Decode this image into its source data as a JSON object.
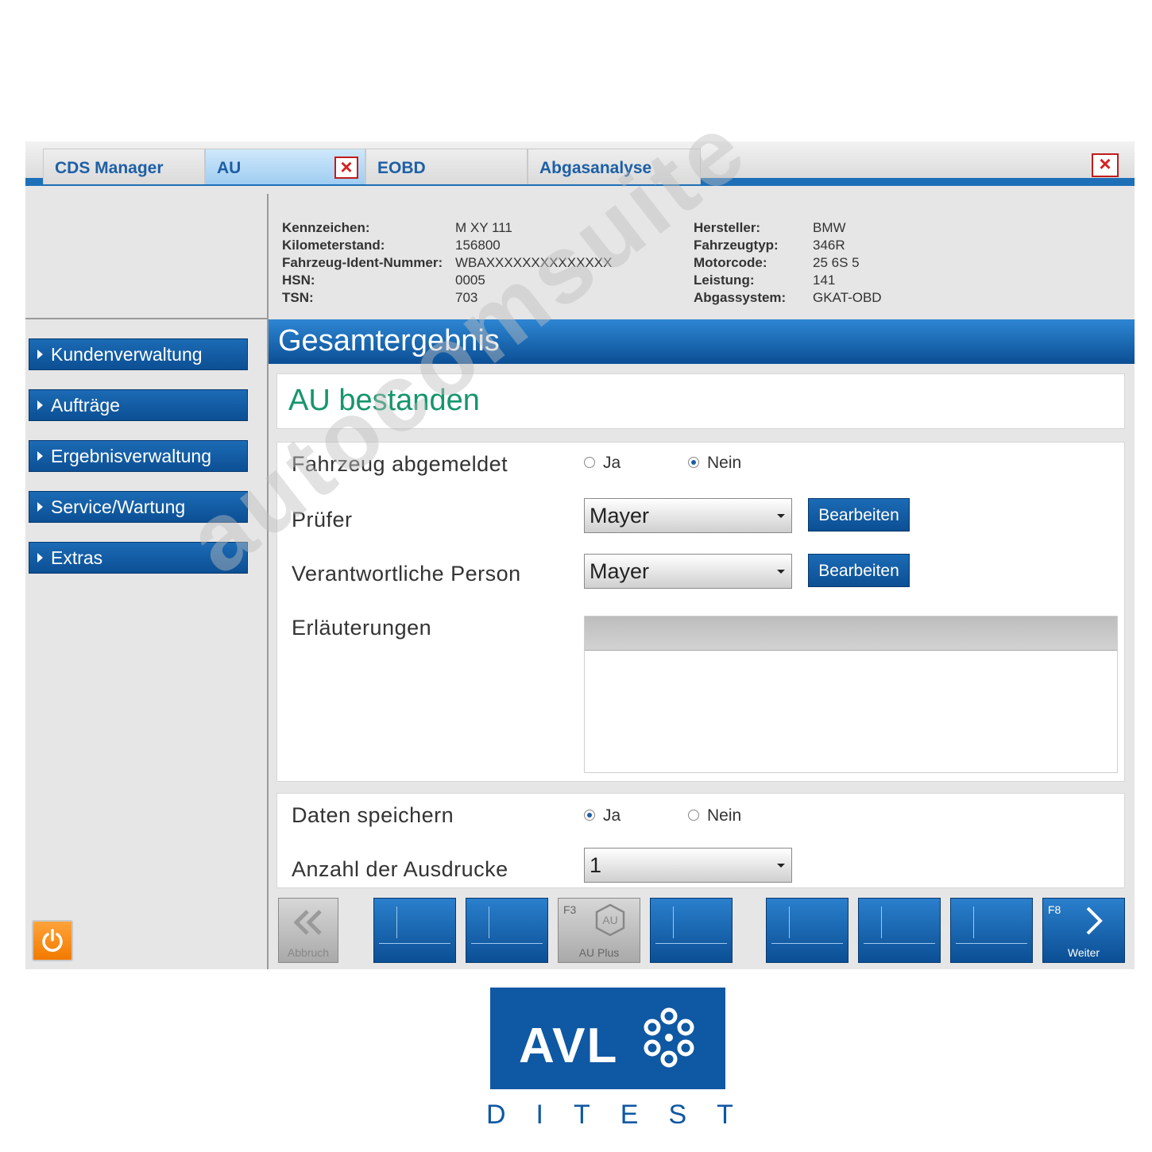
{
  "tabs": [
    {
      "label": "CDS Manager"
    },
    {
      "label": "AU"
    },
    {
      "label": "EOBD"
    },
    {
      "label": "Abgasanalyse"
    }
  ],
  "vehicle": {
    "left": [
      {
        "label": "Kennzeichen:",
        "value": "M XY 111"
      },
      {
        "label": "Kilometerstand:",
        "value": "156800"
      },
      {
        "label": "Fahrzeug-Ident-Nummer:",
        "value": "WBAXXXXXXXXXXXXXX"
      },
      {
        "label": "HSN:",
        "value": "0005"
      },
      {
        "label": "TSN:",
        "value": "703"
      }
    ],
    "right": [
      {
        "label": "Hersteller:",
        "value": "BMW"
      },
      {
        "label": "Fahrzeugtyp:",
        "value": "346R"
      },
      {
        "label": "Motorcode:",
        "value": "25 6S 5"
      },
      {
        "label": "Leistung:",
        "value": "141"
      },
      {
        "label": "Abgassystem:",
        "value": "GKAT-OBD"
      }
    ]
  },
  "sidebar": {
    "items": [
      {
        "label": "Kundenverwaltung"
      },
      {
        "label": "Aufträge"
      },
      {
        "label": "Ergebnisverwaltung"
      },
      {
        "label": "Service/Wartung"
      },
      {
        "label": "Extras"
      }
    ]
  },
  "header": {
    "title": "Gesamtergebnis"
  },
  "result": {
    "text": "AU bestanden",
    "color": "#15966a"
  },
  "form": {
    "abgemeldet": {
      "label": "Fahrzeug abgemeldet",
      "yes": "Ja",
      "no": "Nein",
      "selected": "Nein"
    },
    "pruefer": {
      "label": "Prüfer",
      "value": "Mayer",
      "edit": "Bearbeiten"
    },
    "verantwortlich": {
      "label": "Verantwortliche Person",
      "value": "Mayer",
      "edit": "Bearbeiten"
    },
    "erlaeuterungen": {
      "label": "Erläuterungen"
    },
    "speichern": {
      "label": "Daten speichern",
      "yes": "Ja",
      "no": "Nein",
      "selected": "Ja"
    },
    "ausdrucke": {
      "label": "Anzahl der Ausdrucke",
      "value": "1"
    }
  },
  "fkeys": {
    "abbruch": "Abbruch",
    "f3_key": "F3",
    "auplus_icon_text": "AU",
    "auplus": "AU Plus",
    "f8_key": "F8",
    "weiter": "Weiter"
  },
  "watermark": "autocomsuite",
  "logo": {
    "brand": "AVL",
    "tagline": "DITEST"
  },
  "colors": {
    "accent": "#1d6fb8",
    "nav": "#0c4f94",
    "power": "#f27a00"
  }
}
